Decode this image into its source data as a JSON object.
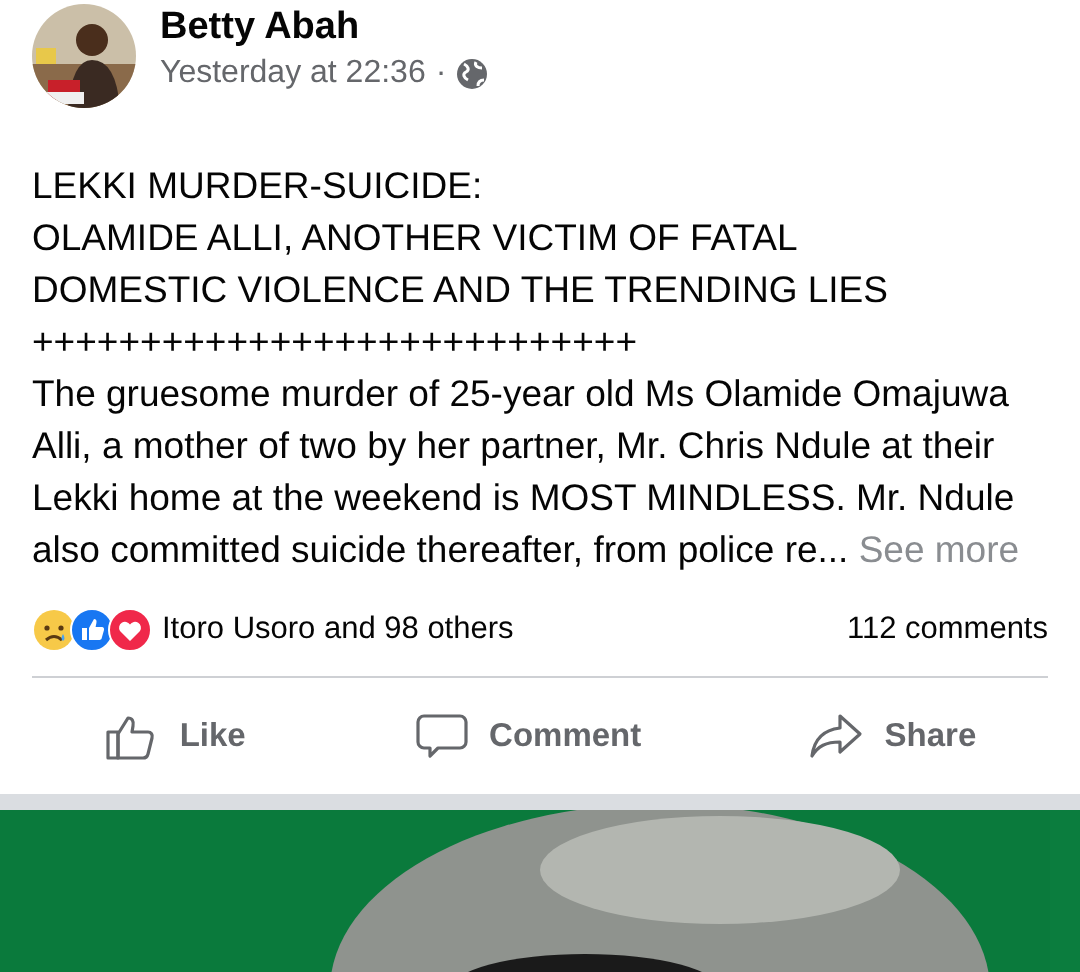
{
  "post": {
    "author": "Betty Abah",
    "time": "Yesterday at 22:36",
    "separator": "·",
    "headline": [
      "LEKKI MURDER-SUICIDE:",
      "OLAMIDE ALLI, ANOTHER VICTIM OF FATAL DOMESTIC VIOLENCE AND THE TRENDING LIES",
      "++++++++++++++++++++++++++++"
    ],
    "body": "The gruesome murder of 25-year old Ms Olamide Omajuwa Alli, a mother of two by her partner, Mr. Chris Ndule at their Lekki home at the weekend is MOST MINDLESS. Mr. Ndule also committed suicide thereafter, from police re...",
    "see_more": "See more",
    "reactions": {
      "kinds": [
        {
          "kind": "sad"
        },
        {
          "kind": "like"
        },
        {
          "kind": "love"
        }
      ],
      "summary": "Itoro Usoro and 98 others"
    },
    "comments": "112 comments",
    "actions": [
      {
        "kind": "like",
        "label": "Like"
      },
      {
        "kind": "comment",
        "label": "Comment"
      },
      {
        "kind": "share",
        "label": "Share"
      }
    ]
  }
}
